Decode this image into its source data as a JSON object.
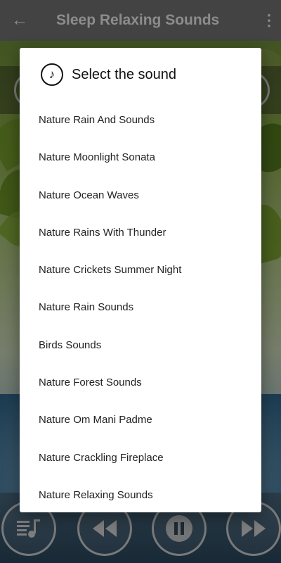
{
  "app": {
    "title": "Sleep Relaxing Sounds",
    "back_icon": "arrow-back-icon",
    "menu_icon": "more-vert-icon"
  },
  "dialog": {
    "title": "Select the sound",
    "icon": "music-note-icon",
    "items": [
      {
        "label": "Nature Rain And Sounds"
      },
      {
        "label": "Nature Moonlight Sonata"
      },
      {
        "label": "Nature Ocean Waves"
      },
      {
        "label": "Nature Rains With Thunder"
      },
      {
        "label": "Nature Crickets Summer Night"
      },
      {
        "label": "Nature Rain Sounds"
      },
      {
        "label": "Birds Sounds"
      },
      {
        "label": "Nature Forest Sounds"
      },
      {
        "label": "Nature Om Mani Padme"
      },
      {
        "label": "Nature Crackling Fireplace"
      },
      {
        "label": "Nature Relaxing Sounds"
      }
    ]
  },
  "controls": {
    "playlist_icon": "playlist-music-icon",
    "rewind_icon": "rewind-icon",
    "pause_icon": "pause-icon",
    "forward_icon": "fast-forward-icon"
  },
  "colors": {
    "appbar": "#7a7a7a",
    "dialog_bg": "#ffffff",
    "scrim": "rgba(0,0,0,0.45)"
  }
}
